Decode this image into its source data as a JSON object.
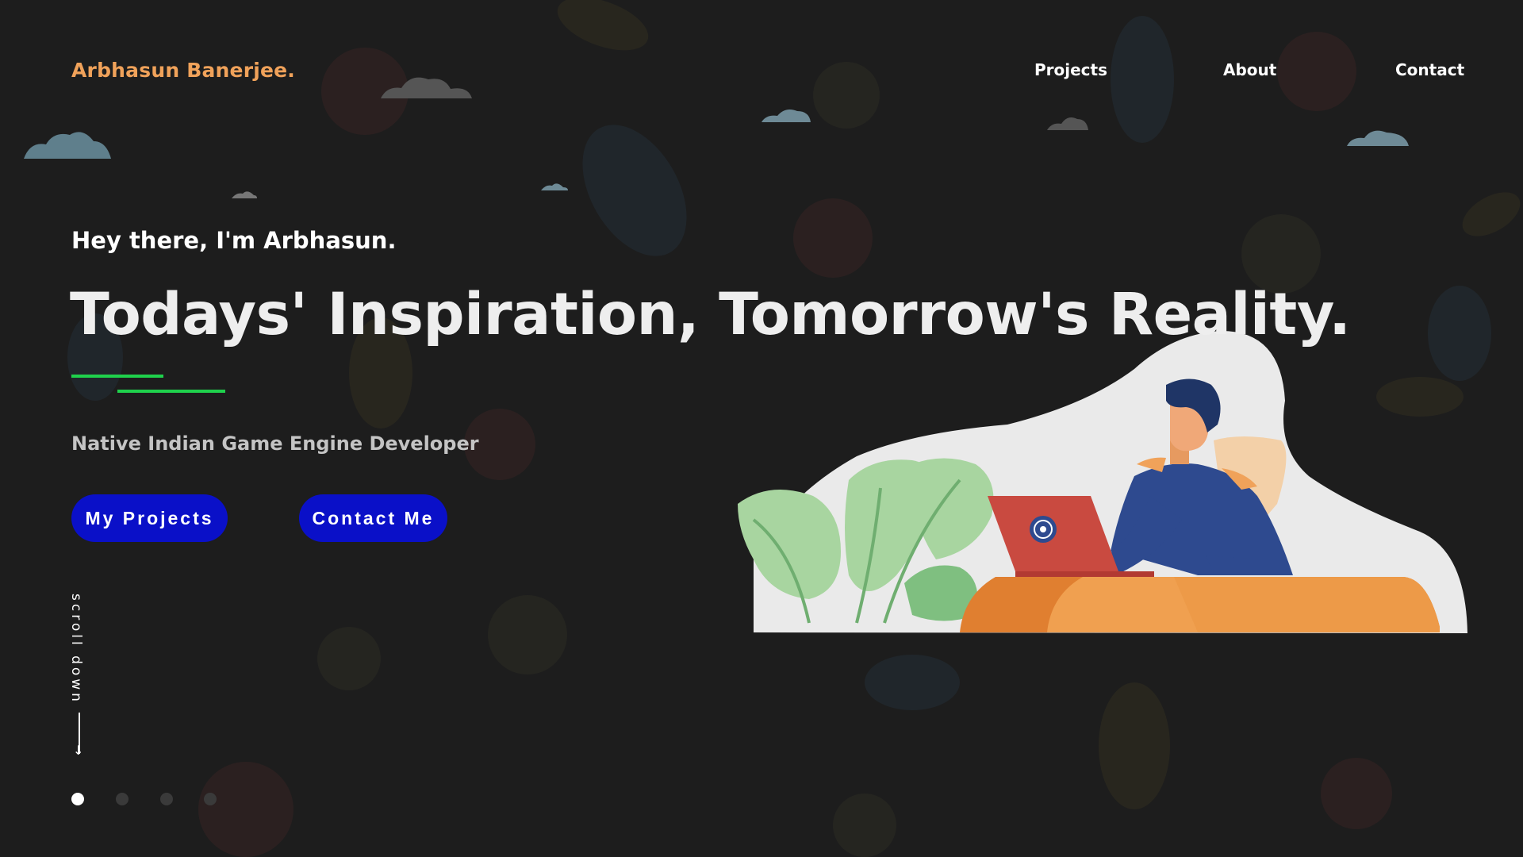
{
  "header": {
    "logo_text": "Arbhasun Banerjee.",
    "nav": [
      {
        "label": "Projects"
      },
      {
        "label": "About"
      },
      {
        "label": "Contact"
      }
    ]
  },
  "hero": {
    "greeting": "Hey there, I'm Arbhasun.",
    "headline": "Todays' Inspiration, Tomorrow's Reality.",
    "subtitle": "Native Indian Game Engine Developer",
    "buttons": {
      "projects_label": "My Projects",
      "contact_label": "Contact Me"
    },
    "scroll_text": "scroll down",
    "scroll_arrow": "↓"
  },
  "pagination": {
    "total": 4,
    "active_index": 1
  },
  "colors": {
    "background": "#1d1d1d",
    "logo": "#f0a25a",
    "accent_green": "#1fd14c",
    "button": "#0a10c8",
    "subtitle": "#c4c4c4"
  },
  "icons": {
    "illustration": "developer-at-laptop-illustration",
    "clouds": "cloud-icon",
    "scroll_arrow": "down-arrow-icon"
  }
}
